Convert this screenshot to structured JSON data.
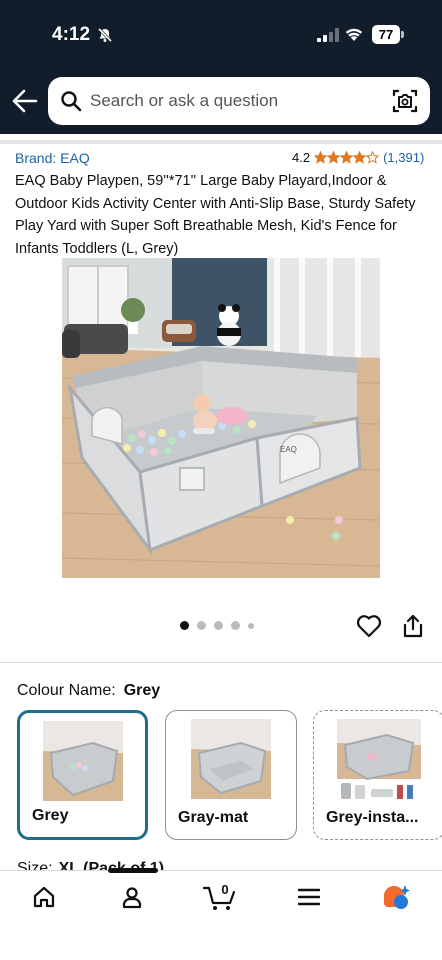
{
  "status_bar": {
    "time": "4:12",
    "battery": "77"
  },
  "search": {
    "placeholder": "Search or ask a question"
  },
  "product": {
    "brand": "Brand: EAQ",
    "rating": "4.2",
    "rating_stars": 4.2,
    "rating_count": "(1,391)",
    "title": "EAQ Baby Playpen, 59''*71'' Large Baby Playard,Indoor & Outdoor Kids Activity Center with Anti-Slip Base, Sturdy Safety Play Yard with Super Soft Breathable Mesh, Kid's Fence for Infants Toddlers (L, Grey)",
    "image_brand": "EAQ"
  },
  "carousel": {
    "total_dots": 5,
    "active_index": 0
  },
  "colour": {
    "label": "Colour Name:",
    "selected": "Grey",
    "options": [
      {
        "label": "Grey"
      },
      {
        "label": "Gray-mat"
      },
      {
        "label": "Grey-insta..."
      }
    ]
  },
  "size": {
    "label": "Size:",
    "value": "XL (Pack of 1)"
  },
  "nav": {
    "cart_count": "0"
  },
  "colors": {
    "header_bg": "#121d2b",
    "link": "#2162a1",
    "star": "#de7921",
    "selected_border": "#1f6e8c"
  }
}
